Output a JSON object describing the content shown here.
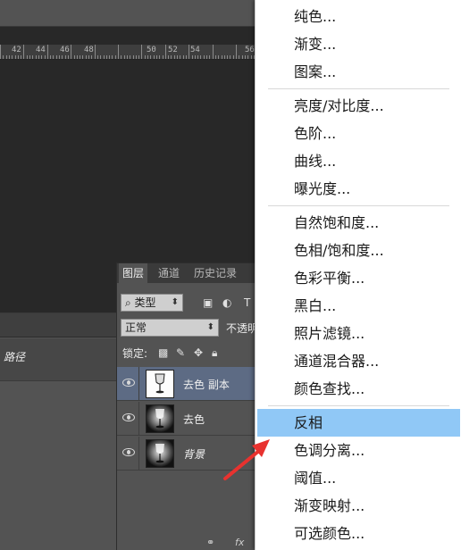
{
  "ruler": {
    "labels": [
      "42",
      "44",
      "46",
      "48",
      "50",
      "52",
      "54",
      "56"
    ]
  },
  "paths_panel": {
    "row_label": "路径"
  },
  "layers_panel": {
    "tabs": [
      "图层",
      "通道",
      "历史记录"
    ],
    "filter_kind": "类型",
    "blend_mode": "正常",
    "opacity_label": "不透明",
    "lock_label": "锁定:",
    "layers": [
      {
        "name": "去色 副本",
        "selected": true,
        "thumb": "white"
      },
      {
        "name": "去色",
        "selected": false,
        "thumb": "dark"
      },
      {
        "name": "背景",
        "selected": false,
        "thumb": "dark",
        "italic": true
      }
    ]
  },
  "menu": {
    "items": [
      "纯色...",
      "渐变...",
      "图案...",
      "亮度/对比度...",
      "色阶...",
      "曲线...",
      "曝光度...",
      "自然饱和度...",
      "色相/饱和度...",
      "色彩平衡...",
      "黑白...",
      "照片滤镜...",
      "通道混合器...",
      "颜色查找...",
      "反相",
      "色调分离...",
      "阈值...",
      "渐变映射...",
      "可选颜色..."
    ],
    "highlighted": "反相",
    "highlight_color": "#90c8f6"
  },
  "annotation": {
    "arrow_color": "#e8322f"
  }
}
